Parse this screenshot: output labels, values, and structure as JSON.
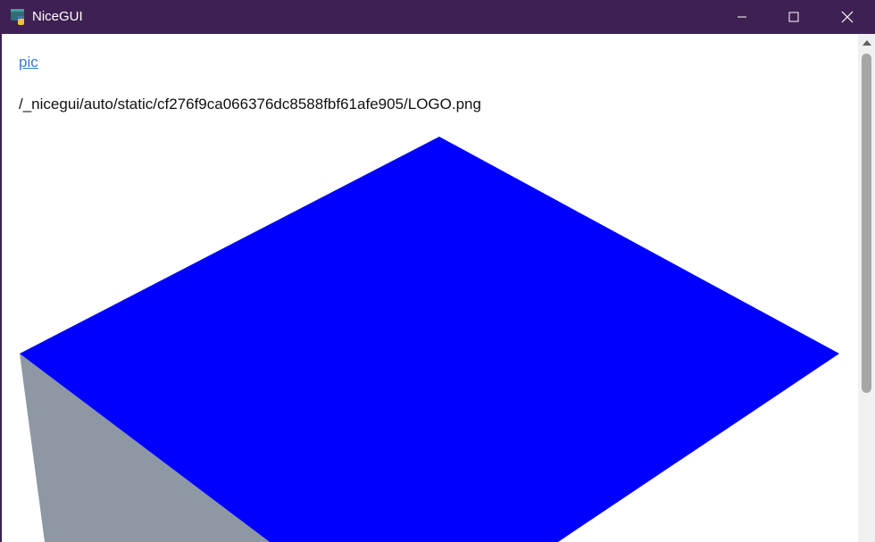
{
  "window": {
    "title": "NiceGUI",
    "icon": "python-icon",
    "controls": {
      "minimize_icon": "minimize-icon",
      "maximize_icon": "maximize-icon",
      "close_icon": "close-icon"
    }
  },
  "main": {
    "link_label": "pic",
    "image_path": "/_nicegui/auto/static/cf276f9ca066376dc8588fbf61afe905/LOGO.png"
  },
  "colors": {
    "titlebar": "#3f2052",
    "link": "#3c7bd6",
    "cube_top": "#0000ff",
    "cube_side": "#8e98a4"
  }
}
